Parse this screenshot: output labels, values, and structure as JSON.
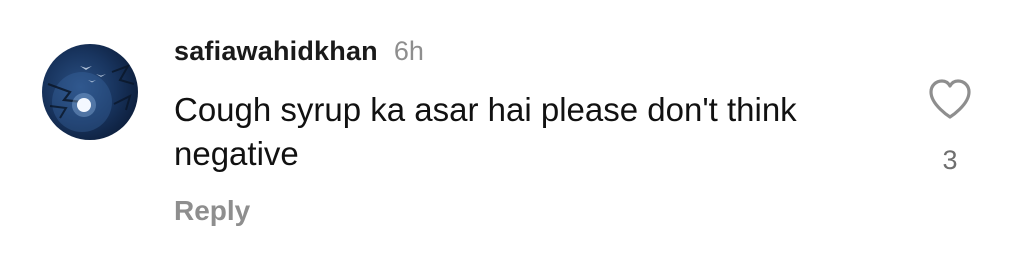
{
  "comment": {
    "avatar": {
      "icon": "user-avatar-night-sky"
    },
    "username": "safiawahidkhan",
    "time": "6h",
    "text": "Cough syrup ka asar hai please don't think negative",
    "reply_label": "Reply",
    "like": {
      "icon": "heart-outline-icon",
      "count": "3"
    }
  },
  "colors": {
    "text": "#111111",
    "muted": "#8e8e8e",
    "count": "#6f6f6f",
    "avatar_bg": "#18345e"
  }
}
